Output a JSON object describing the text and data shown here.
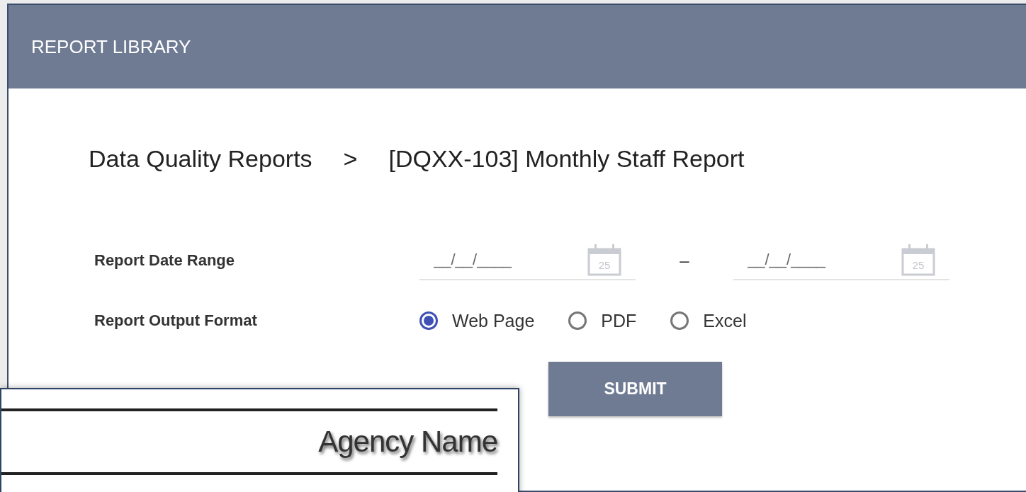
{
  "header": {
    "title": "REPORT LIBRARY"
  },
  "breadcrumb": {
    "parent": "Data Quality Reports",
    "separator": ">",
    "current": "[DQXX-103] Monthly Staff Report"
  },
  "form": {
    "rows": [
      {
        "kind": "date_range",
        "label": "Report Date Range",
        "start": {
          "placeholder": "__/__/____",
          "calendar_day": "25"
        },
        "separator": "–",
        "end": {
          "placeholder": "__/__/____",
          "calendar_day": "25"
        }
      },
      {
        "kind": "radio_group",
        "label": "Report Output Format",
        "options": [
          {
            "label": "Web Page",
            "selected": true
          },
          {
            "label": "PDF",
            "selected": false
          },
          {
            "label": "Excel",
            "selected": false
          }
        ]
      }
    ],
    "submit": "SUBMIT"
  },
  "overlay": {
    "text": "Agency Name"
  }
}
